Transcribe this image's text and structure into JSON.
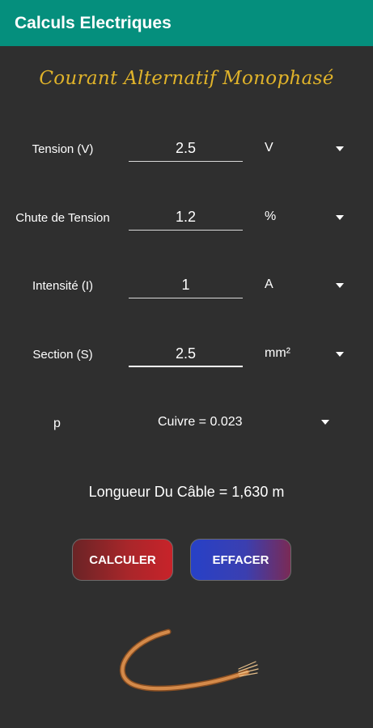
{
  "appbar": {
    "title": "Calculs Electriques"
  },
  "subtitle": "Courant Alternatif Monophasé",
  "rows": [
    {
      "label": "Tension (V)",
      "value": "2.5",
      "unit": "V"
    },
    {
      "label": "Chute de Tension",
      "value": "1.2",
      "unit": "%"
    },
    {
      "label": "Intensité (I)",
      "value": "1",
      "unit": "A"
    },
    {
      "label": "Section (S)",
      "value": "2.5",
      "unit": "mm²"
    }
  ],
  "resistivity": {
    "label": "p",
    "selected": "Cuivre = 0.023"
  },
  "result": "Longueur Du Câble =  1,630 m",
  "buttons": {
    "calculate": "CALCULER",
    "clear": "EFFACER"
  },
  "colors": {
    "appbar": "#058f7d",
    "background": "#2f2f2f",
    "subtitle": "#e0b32a",
    "calculate_button": "#c8232a",
    "clear_button": "#2741c7",
    "cable": "#d48a4a"
  },
  "icons": {
    "cable": "copper-cable-icon",
    "dropdown": "caret-down-icon"
  }
}
